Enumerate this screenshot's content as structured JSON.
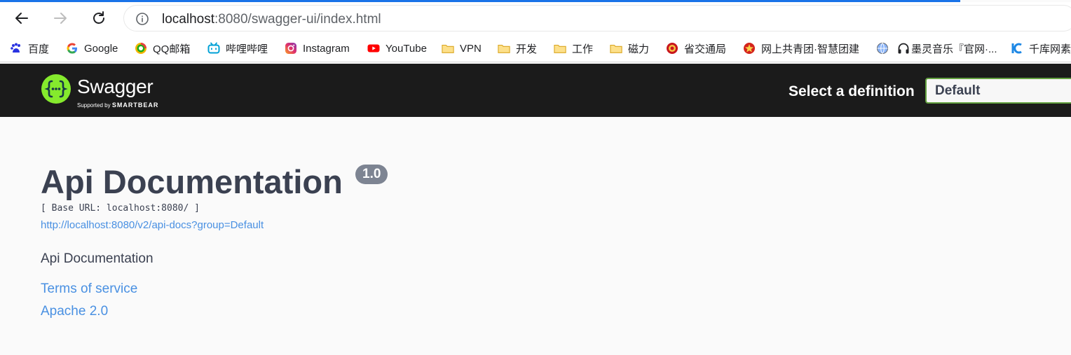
{
  "browser": {
    "url_host": "localhost",
    "url_rest": ":8080/swagger-ui/index.html",
    "accent": "#1a73e8"
  },
  "bookmarks": [
    {
      "label": "百度",
      "icon": "baidu-icon"
    },
    {
      "label": "Google",
      "icon": "google-icon"
    },
    {
      "label": "QQ邮箱",
      "icon": "qqmail-icon"
    },
    {
      "label": "哔哩哔哩",
      "icon": "bilibili-icon"
    },
    {
      "label": "Instagram",
      "icon": "instagram-icon"
    },
    {
      "label": "YouTube",
      "icon": "youtube-icon"
    },
    {
      "label": "VPN",
      "icon": "folder-icon"
    },
    {
      "label": "开发",
      "icon": "folder-icon"
    },
    {
      "label": "工作",
      "icon": "folder-icon"
    },
    {
      "label": "磁力",
      "icon": "folder-icon"
    },
    {
      "label": "省交通局",
      "icon": "emblem-icon"
    },
    {
      "label": "网上共青团·智慧团建",
      "icon": "emblem-icon"
    },
    {
      "label": "",
      "icon": "globe-icon"
    },
    {
      "label": "墨灵音乐『官网·...",
      "icon": "headphones-icon"
    },
    {
      "label": "千库网素",
      "icon": "qianku-icon"
    }
  ],
  "swagger": {
    "brand": "Swagger",
    "supported_by": "Supported by",
    "smartbear": "SMARTBEAR",
    "select_label": "Select a definition",
    "selected_definition": "Default",
    "brand_color": "#85ea2d"
  },
  "info": {
    "title": "Api Documentation",
    "version": "1.0",
    "base_url": "[ Base URL: localhost:8080/ ]",
    "docs_url": "http://localhost:8080/v2/api-docs?group=Default",
    "description": "Api Documentation",
    "terms": "Terms of service",
    "license": "Apache 2.0"
  }
}
